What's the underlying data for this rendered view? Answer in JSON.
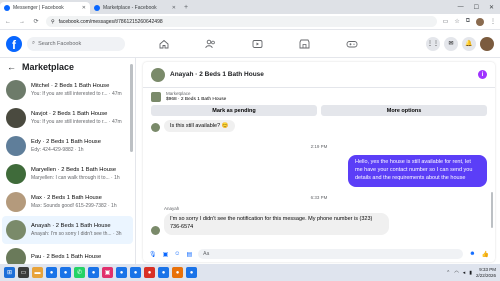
{
  "browser": {
    "tabs": [
      {
        "label": "Messenger | Facebook",
        "active": true
      },
      {
        "label": "Marketplace - Facebook",
        "active": false
      }
    ],
    "new_tab": "+",
    "window_controls": [
      "—",
      "☐",
      "✕"
    ],
    "url": "facebook.com/messages/t/7861215260642498"
  },
  "fb": {
    "logo": "f",
    "search_placeholder": "Search Facebook",
    "nav_icons": [
      "home-icon",
      "friends-icon",
      "video-icon",
      "marketplace-icon",
      "gaming-icon"
    ],
    "right_icons": [
      "menu-grid-icon",
      "messenger-icon",
      "bell-icon"
    ]
  },
  "left": {
    "title": "Marketplace",
    "back": "←",
    "conversations": [
      {
        "name": "Mitchel · 2 Beds 1 Bath House",
        "snippet": "You: If you are still interested to r... · 47m",
        "color": "#6d7b6a",
        "active": false
      },
      {
        "name": "Navjot · 2 Beds 1 Bath House",
        "snippet": "You: If you are still interested to r... · 47m",
        "color": "#4a4a3f",
        "active": false
      },
      {
        "name": "Edy · 2 Beds 1 Bath House",
        "snippet": "Edy: 424-429-9882 · 1h",
        "color": "#5f7e9a",
        "active": false
      },
      {
        "name": "Maryellen · 2 Beds 1 Bath House",
        "snippet": "Maryellen: I can walk through it to... · 1h",
        "color": "#3f6b3a",
        "active": false
      },
      {
        "name": "Max · 2 Beds 1 Bath House",
        "snippet": "Max: Sounds good! 615-299-7382 · 1h",
        "color": "#b49a7c",
        "active": false
      },
      {
        "name": "Anayah · 2 Beds 1 Bath House",
        "snippet": "Anayah: I'm so sorry I didn't see th... · 3h",
        "color": "#7a8a6a",
        "active": true
      },
      {
        "name": "Pau · 2 Beds 1 Bath House",
        "snippet": "",
        "color": "#6a7a5a",
        "active": false
      }
    ]
  },
  "chat": {
    "title": "Anayah · 2 Beds 1 Bath House",
    "listing_label": "Marketplace",
    "listing_price": "$968 · 2 Beds 1 Bath House",
    "mark_pending": "Mark as pending",
    "more_options": "More options",
    "msg1": "Is this still available? 😊",
    "time1": "2:19 PM",
    "msg_out": "Hello, yes the house is still available for rent, let me have your contact number so I can send you details and the requirements about the house",
    "time2": "6:33 PM",
    "sender": "Anayah",
    "msg2": "I'm so sorry I didn't see the notification for this message. My phone number is (323) 736-6574",
    "composer_placeholder": "Aa",
    "accent": "#5b3ef7"
  },
  "taskbar": {
    "time": "9:33 PM",
    "date": "2/22/2026"
  }
}
